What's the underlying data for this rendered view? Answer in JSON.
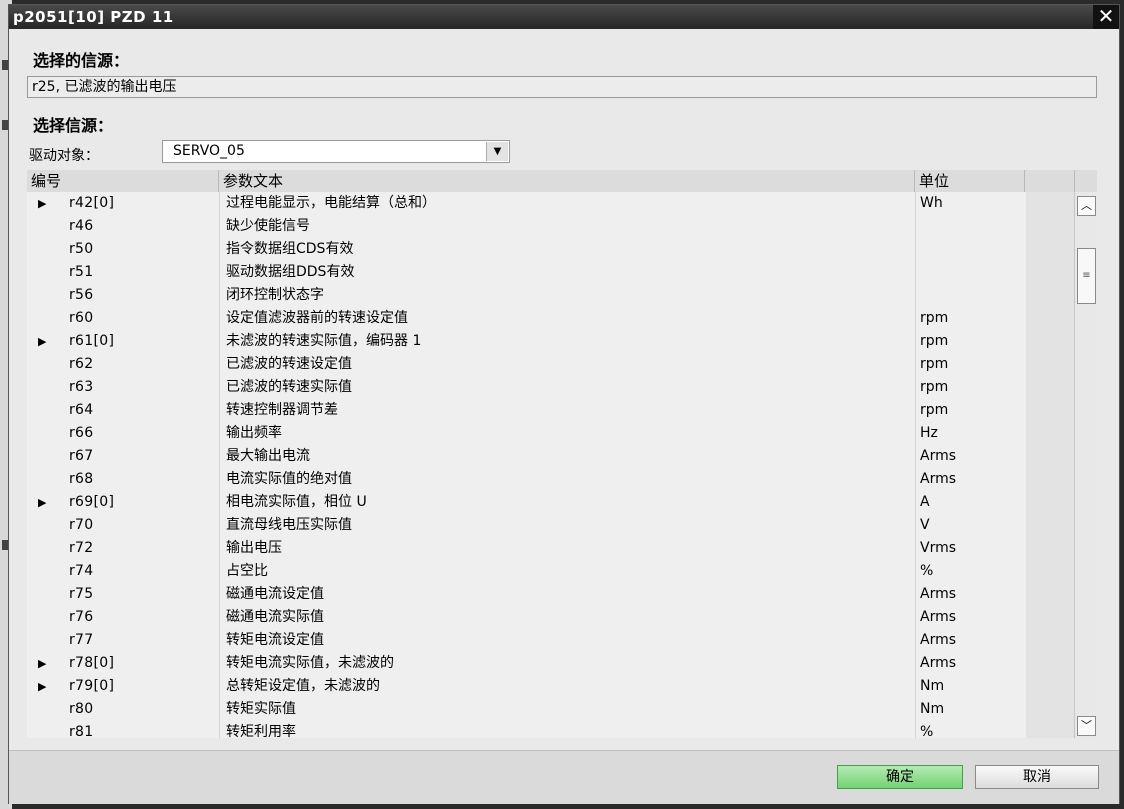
{
  "window": {
    "title": "p2051[10] PZD 11",
    "close_glyph": "✕"
  },
  "selected_source": {
    "label": "选择的信源：",
    "value": "r25, 已滤波的输出电压"
  },
  "select_source": {
    "label": "选择信源：",
    "drive_label": "驱动对象：",
    "drive_value": "SERVO_05"
  },
  "table": {
    "headers": {
      "number": "编号",
      "text": "参数文本",
      "unit": "单位"
    },
    "rows": [
      {
        "expand": "▶",
        "number": "r42[0]",
        "text": "过程电能显示，电能结算（总和）",
        "unit": "Wh"
      },
      {
        "expand": "",
        "number": "r46",
        "text": "缺少使能信号",
        "unit": ""
      },
      {
        "expand": "",
        "number": "r50",
        "text": "指令数据组CDS有效",
        "unit": ""
      },
      {
        "expand": "",
        "number": "r51",
        "text": "驱动数据组DDS有效",
        "unit": ""
      },
      {
        "expand": "",
        "number": "r56",
        "text": "闭环控制状态字",
        "unit": ""
      },
      {
        "expand": "",
        "number": "r60",
        "text": "设定值滤波器前的转速设定值",
        "unit": "rpm"
      },
      {
        "expand": "▶",
        "number": "r61[0]",
        "text": "未滤波的转速实际值，编码器 1",
        "unit": "rpm"
      },
      {
        "expand": "",
        "number": "r62",
        "text": "已滤波的转速设定值",
        "unit": "rpm"
      },
      {
        "expand": "",
        "number": "r63",
        "text": "已滤波的转速实际值",
        "unit": "rpm"
      },
      {
        "expand": "",
        "number": "r64",
        "text": "转速控制器调节差",
        "unit": "rpm"
      },
      {
        "expand": "",
        "number": "r66",
        "text": "输出频率",
        "unit": "Hz"
      },
      {
        "expand": "",
        "number": "r67",
        "text": "最大输出电流",
        "unit": "Arms"
      },
      {
        "expand": "",
        "number": "r68",
        "text": "电流实际值的绝对值",
        "unit": "Arms"
      },
      {
        "expand": "▶",
        "number": "r69[0]",
        "text": "相电流实际值，相位 U",
        "unit": "A"
      },
      {
        "expand": "",
        "number": "r70",
        "text": "直流母线电压实际值",
        "unit": "V"
      },
      {
        "expand": "",
        "number": "r72",
        "text": "输出电压",
        "unit": "Vrms"
      },
      {
        "expand": "",
        "number": "r74",
        "text": "占空比",
        "unit": "%"
      },
      {
        "expand": "",
        "number": "r75",
        "text": "磁通电流设定值",
        "unit": "Arms"
      },
      {
        "expand": "",
        "number": "r76",
        "text": "磁通电流实际值",
        "unit": "Arms"
      },
      {
        "expand": "",
        "number": "r77",
        "text": "转矩电流设定值",
        "unit": "Arms"
      },
      {
        "expand": "▶",
        "number": "r78[0]",
        "text": "转矩电流实际值，未滤波的",
        "unit": "Arms"
      },
      {
        "expand": "▶",
        "number": "r79[0]",
        "text": "总转矩设定值，未滤波的",
        "unit": "Nm"
      },
      {
        "expand": "",
        "number": "r80",
        "text": "转矩实际值",
        "unit": "Nm"
      },
      {
        "expand": "",
        "number": "r81",
        "text": "转矩利用率",
        "unit": "%"
      }
    ]
  },
  "scrollbar": {
    "up_glyph": "︿",
    "down_glyph": "﹀",
    "thumb_glyph": "≡"
  },
  "buttons": {
    "ok": "确定",
    "cancel": "取消"
  }
}
